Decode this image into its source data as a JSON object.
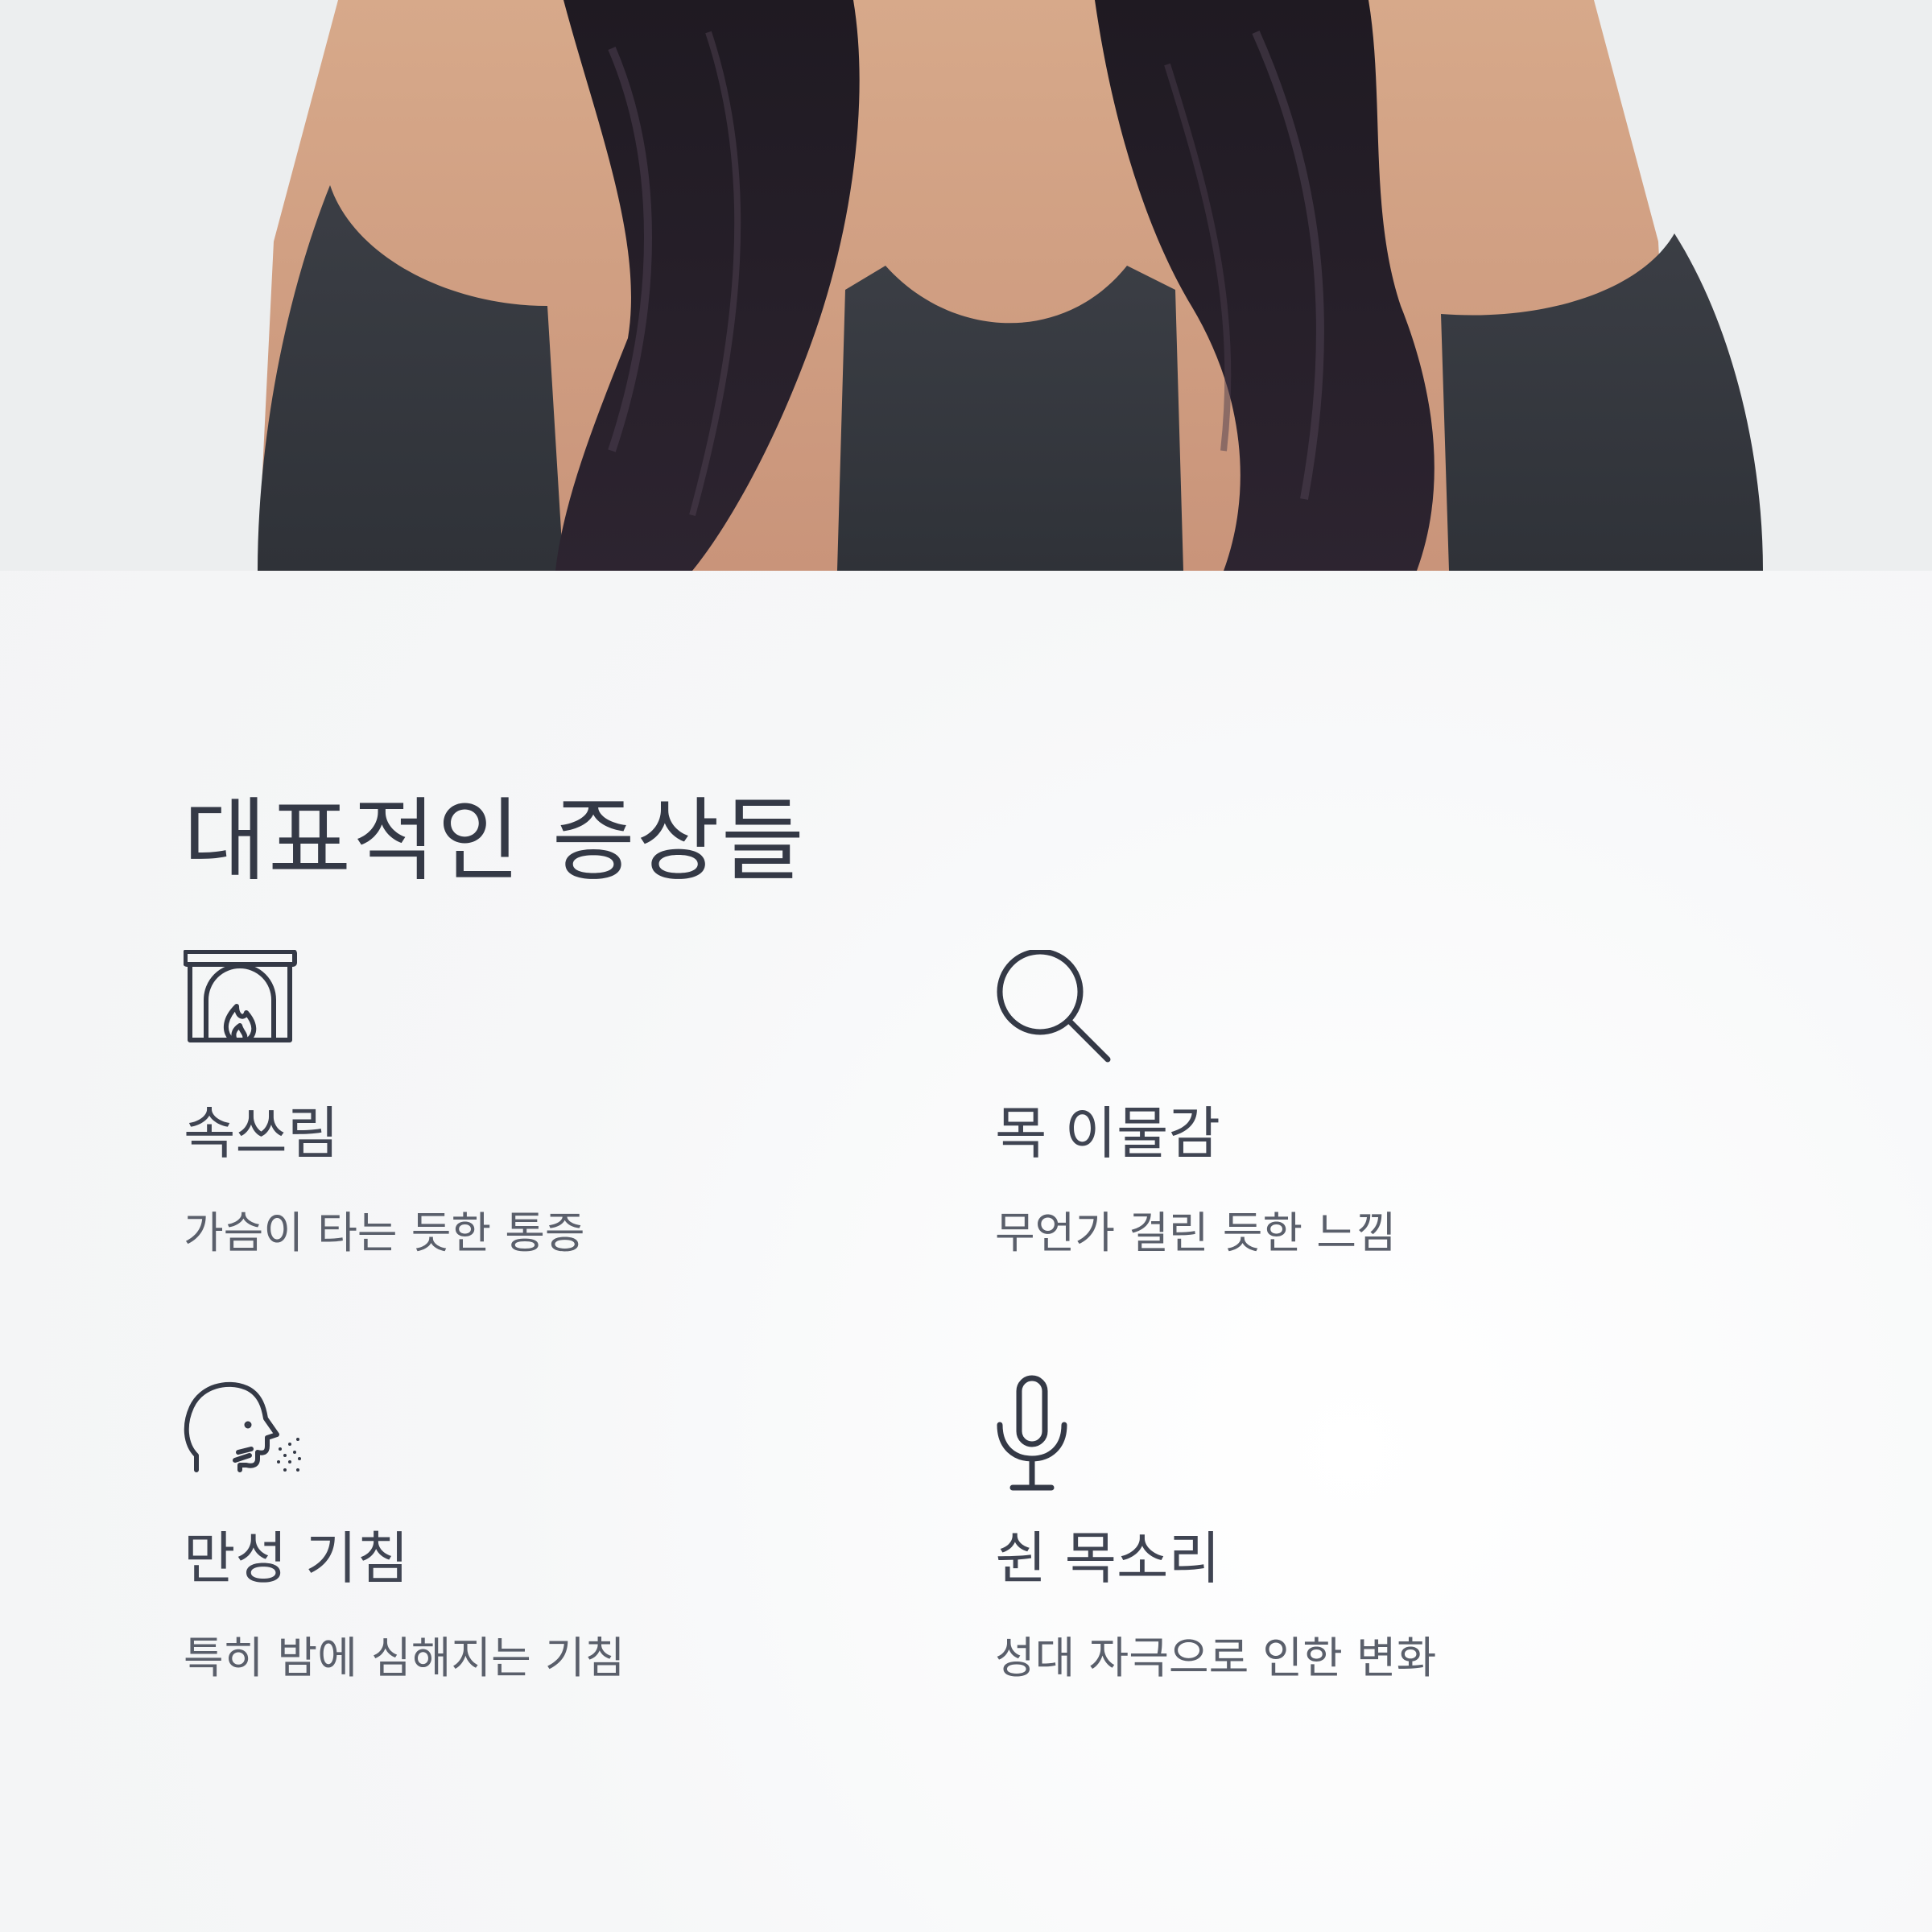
{
  "section": {
    "title": "대표적인 증상들"
  },
  "symptoms": [
    {
      "icon": "fireplace-icon",
      "label": "속쓰림",
      "description": "가슴이 타는 듯한 통증"
    },
    {
      "icon": "search-icon",
      "label": "목 이물감",
      "description": "무언가 걸린 듯한 느낌"
    },
    {
      "icon": "coughing-head-icon",
      "label": "만성 기침",
      "description": "특히 밤에 심해지는 기침"
    },
    {
      "icon": "microphone-icon",
      "label": "쉰 목소리",
      "description": "성대 자극으로 인한 변화"
    }
  ],
  "colors": {
    "text": "#343946",
    "icon": "#343946",
    "background": "#f7f8f9"
  }
}
